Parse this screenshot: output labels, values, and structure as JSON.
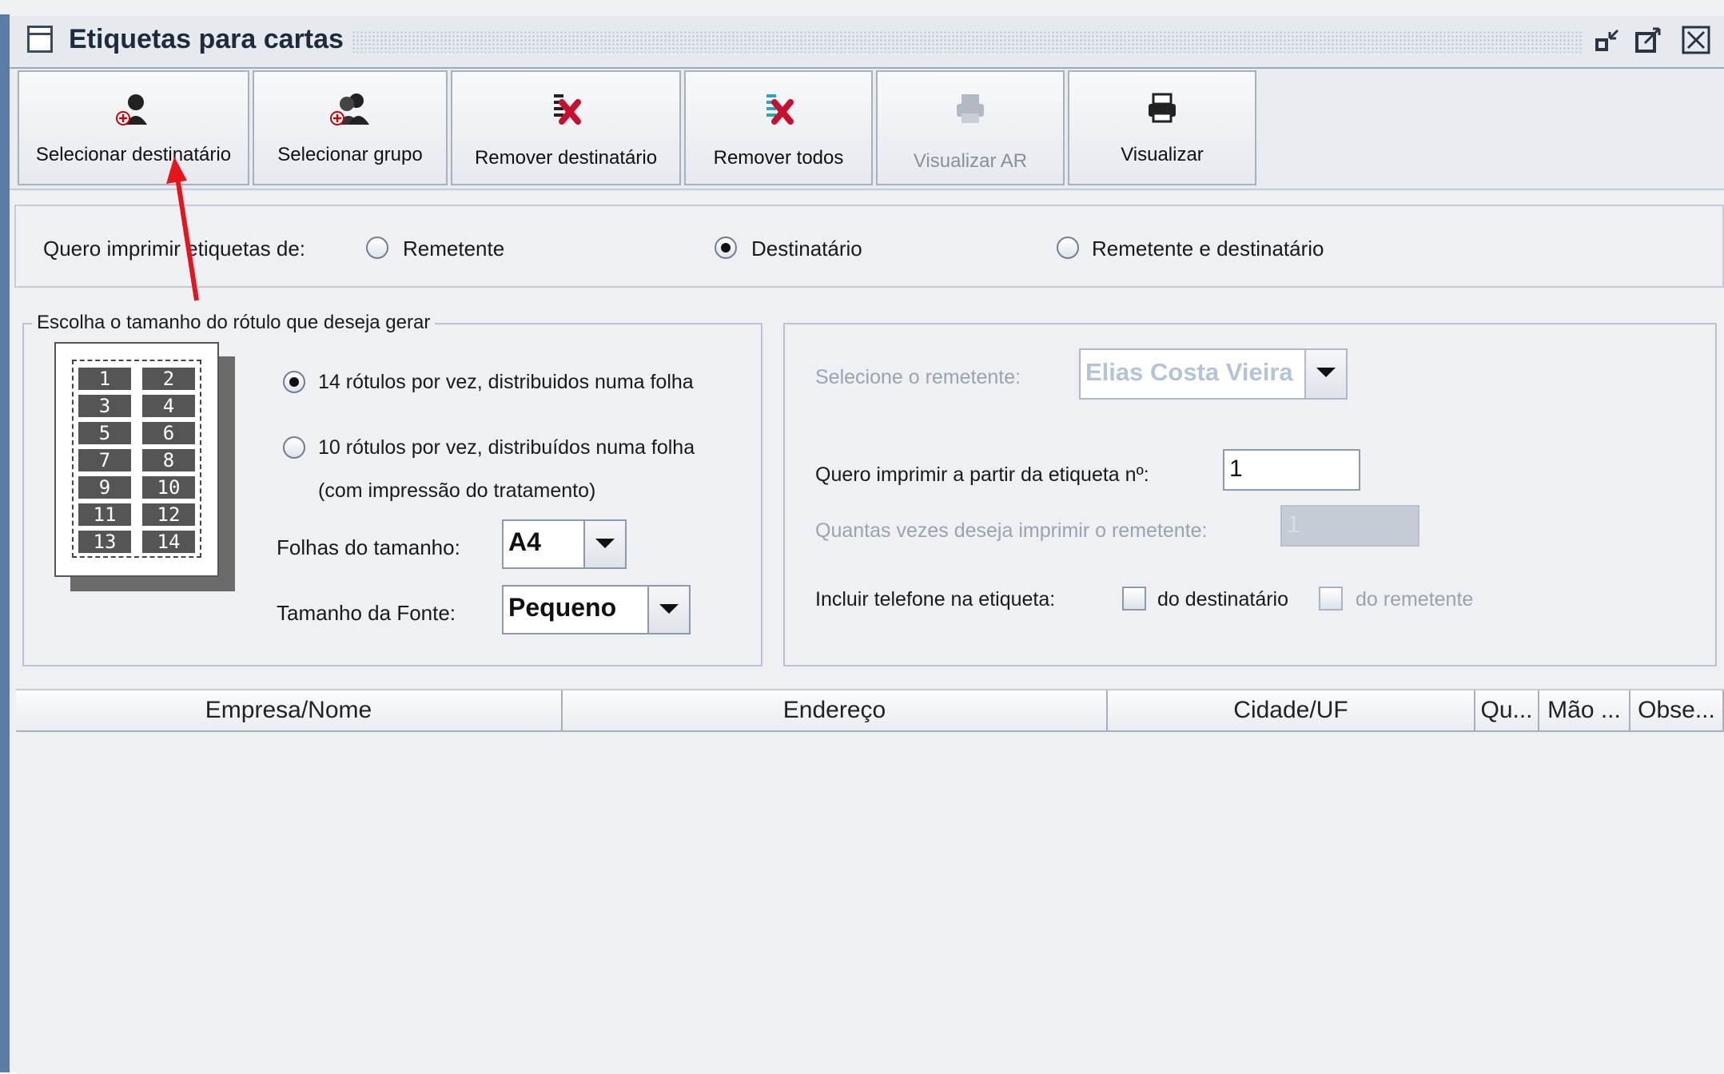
{
  "window": {
    "title": "Etiquetas para cartas",
    "buttons": [
      "minimize-icon",
      "maximize-icon",
      "close-icon"
    ]
  },
  "toolbar": {
    "buttons": [
      {
        "label": "Selecionar destinatário",
        "icon": "add-person-icon",
        "enabled": true
      },
      {
        "label": "Selecionar grupo",
        "icon": "add-group-icon",
        "enabled": true
      },
      {
        "label": "Remover destinatário",
        "icon": "remove-recipient-icon",
        "enabled": true
      },
      {
        "label": "Remover todos",
        "icon": "remove-all-icon",
        "enabled": true
      },
      {
        "label": "Visualizar AR",
        "icon": "printer-icon",
        "enabled": false
      },
      {
        "label": "Visualizar",
        "icon": "printer-icon",
        "enabled": true
      }
    ]
  },
  "print_options": {
    "label": "Quero imprimir etiquetas de:",
    "options": [
      {
        "label": "Remetente",
        "selected": false
      },
      {
        "label": "Destinatário",
        "selected": true
      },
      {
        "label": "Remetente e destinatário",
        "selected": false
      }
    ]
  },
  "size_panel": {
    "legend": "Escolha o tamanho do rótulo que deseja gerar",
    "sheet_numbers": [
      "1",
      "2",
      "3",
      "4",
      "5",
      "6",
      "7",
      "8",
      "9",
      "10",
      "11",
      "12",
      "13",
      "14"
    ],
    "option_14": {
      "label": "14 rótulos por vez, distribuidos numa folha",
      "selected": true
    },
    "option_10": {
      "label": "10 rótulos por vez, distribuídos numa folha",
      "selected": false
    },
    "option_10_note": "(com impressão do tratamento)",
    "sheet_size_label": "Folhas do tamanho:",
    "sheet_size_value": "A4",
    "font_size_label": "Tamanho da Fonte:",
    "font_size_value": "Pequeno"
  },
  "sender_panel": {
    "sender_label": "Selecione o remetente:",
    "sender_value": "Elias Costa Vieira",
    "start_label": "Quero imprimir a partir da etiqueta nº:",
    "start_value": "1",
    "repeat_label": "Quantas vezes deseja imprimir o remetente:",
    "repeat_value": "1",
    "phone_label": "Incluir telefone na etiqueta:",
    "phone_recipient": "do destinatário",
    "phone_sender": "do remetente"
  },
  "table": {
    "columns": [
      "Empresa/Nome",
      "Endereço",
      "Cidade/UF",
      "Qu...",
      "Mão ...",
      "Obse..."
    ],
    "rows": []
  },
  "colors": {
    "frame_border": "#5c7ca8",
    "annotation_arrow": "#e8141b"
  }
}
